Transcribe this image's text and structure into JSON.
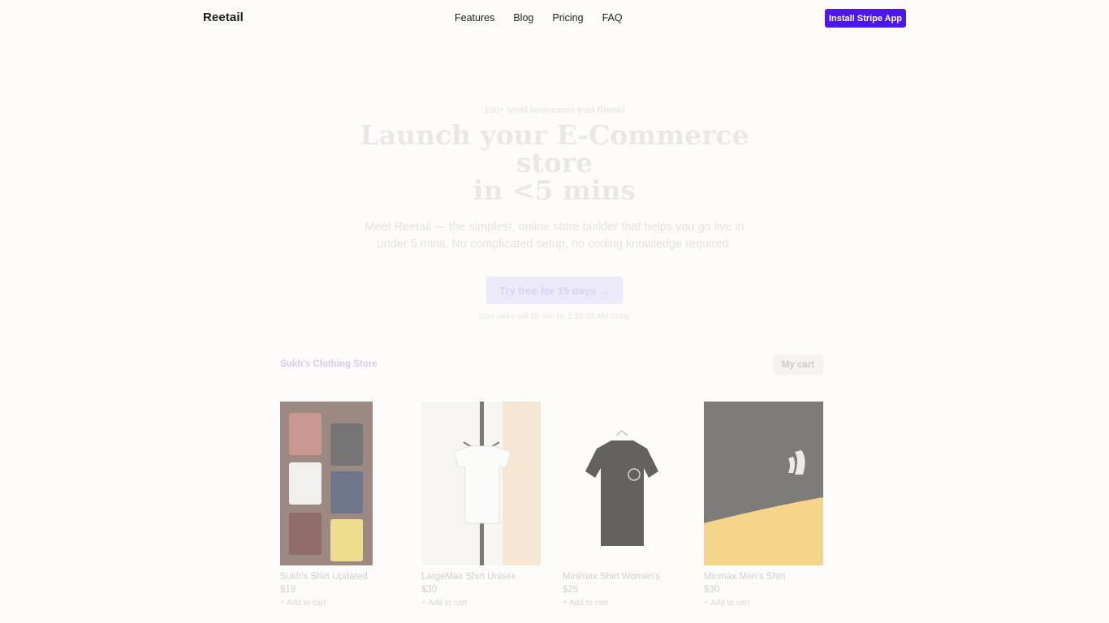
{
  "nav": {
    "logo": "Reetail",
    "links": [
      "Features",
      "Blog",
      "Pricing",
      "FAQ"
    ],
    "install_label": "Install Stripe App"
  },
  "hero": {
    "eyebrow": "100+ small businesses trust Reetail",
    "title_line1": "Launch your E-Commerce store",
    "title_line2": "in <5 mins",
    "subtitle": "Meet Reetail — the simplest, online store builder that helps you go live in under 5 mins. No complicated setup, no coding knowledge required.",
    "cta_label": "Try free for 15 days →",
    "live_note": "Your store will be live by 2:35:03 AM today"
  },
  "store": {
    "name": "Sukh's Clothing Store",
    "cart_label": "My cart",
    "products": [
      {
        "name": "Sukh's Shirt Updated",
        "price": "$19",
        "add_label": "+ Add to cart",
        "image": "folded-shirts-grid"
      },
      {
        "name": "LargeMax Shirt Unisex",
        "price": "$30",
        "add_label": "+ Add to cart",
        "image": "white-shirt-hanger"
      },
      {
        "name": "Minimax Shirt Women's",
        "price": "$25",
        "add_label": "+ Add to cart",
        "image": "black-tshirt-hanger"
      },
      {
        "name": "Minmax Men's Shirt",
        "price": "$30",
        "add_label": "+ Add to cart",
        "image": "north-face-jacket"
      }
    ]
  },
  "colors": {
    "accent": "#4f17f0",
    "background": "#fdfcfa"
  }
}
